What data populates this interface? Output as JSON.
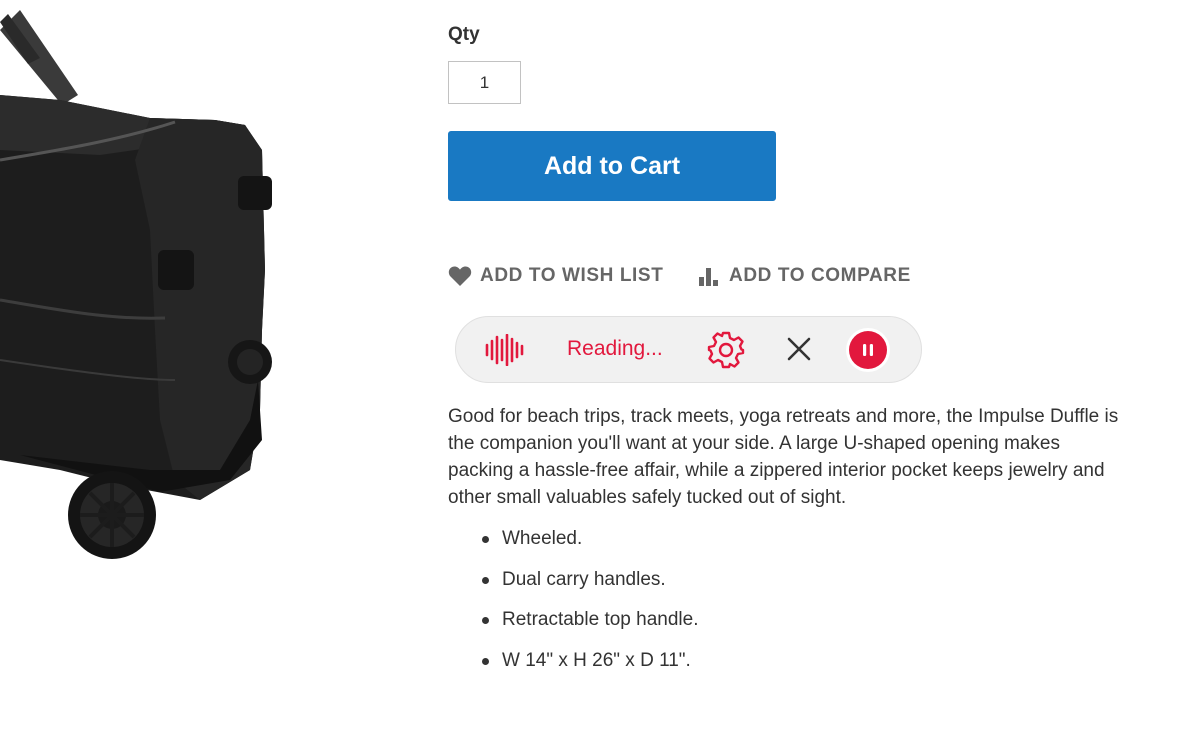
{
  "qty": {
    "label": "Qty",
    "value": "1"
  },
  "cart": {
    "button_label": "Add to Cart"
  },
  "actions": {
    "wishlist_label": "ADD TO WISH LIST",
    "compare_label": "ADD TO COMPARE"
  },
  "reader": {
    "status": "Reading...",
    "accent_color": "#e2183d",
    "icons": [
      "soundwave-icon",
      "gear-icon",
      "close-icon",
      "pause-icon"
    ]
  },
  "description": "Good for beach trips, track meets, yoga retreats and more, the Impulse Duffle is the companion you'll want at your side. A large U-shaped opening makes packing a hassle-free affair, while a zippered interior pocket keeps jewelry and other small valuables safely tucked out of sight.",
  "features": [
    "Wheeled.",
    "Dual carry handles.",
    "Retractable top handle.",
    "W 14\" x H 26\" x D 11\"."
  ],
  "theme": {
    "primary": "#1979c3",
    "text": "#333333",
    "link": "#666666"
  }
}
